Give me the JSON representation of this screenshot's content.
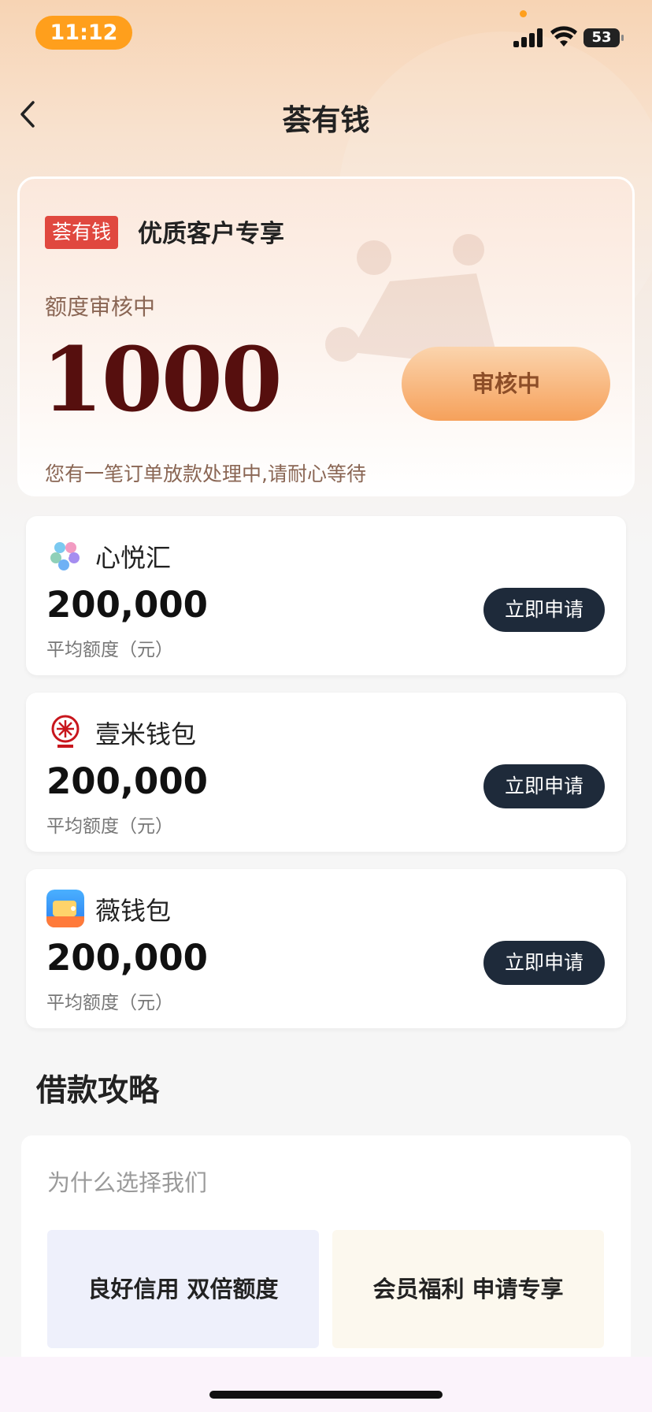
{
  "status_bar": {
    "time": "11:12",
    "battery": "53",
    "signal_icon": "signal-icon",
    "wifi_icon": "wifi-icon"
  },
  "nav": {
    "title": "荟有钱",
    "back_icon": "chevron-left-icon"
  },
  "hero": {
    "tag": "荟有钱",
    "title": "优质客户专享",
    "status": "额度审核中",
    "amount": "1000",
    "button": "审核中",
    "note": "您有一笔订单放款处理中,请耐心等待"
  },
  "products": [
    {
      "name": "心悦汇",
      "amount": "200,000",
      "label": "平均额度（元）",
      "button": "立即申请",
      "icon": "xinyuehui-logo-icon"
    },
    {
      "name": "壹米钱包",
      "amount": "200,000",
      "label": "平均额度（元）",
      "button": "立即申请",
      "icon": "yimi-wallet-logo-icon"
    },
    {
      "name": "薇钱包",
      "amount": "200,000",
      "label": "平均额度（元）",
      "button": "立即申请",
      "icon": "wei-wallet-logo-icon"
    }
  ],
  "guide": {
    "title": "借款攻略",
    "subtitle": "为什么选择我们",
    "tiles": [
      {
        "label": "良好信用 双倍额度"
      },
      {
        "label": "会员福利 申请专享"
      }
    ]
  },
  "colors": {
    "accent": "#ff9f1c",
    "amount": "#560f0e",
    "tag": "#e0483f",
    "apply_button": "#1e2a3a"
  }
}
